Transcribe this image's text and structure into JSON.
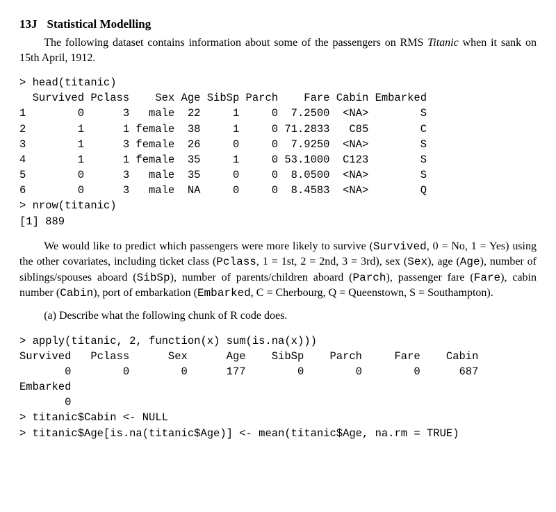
{
  "header": {
    "number": "13J",
    "title": "Statistical Modelling"
  },
  "intro": {
    "line1_a": "The following dataset contains information about some of the passengers on RMS",
    "line1_b_italic": "Titanic",
    "line1_c": " when it sank on 15th April, 1912."
  },
  "code1": "> head(titanic)\n  Survived Pclass    Sex Age SibSp Parch    Fare Cabin Embarked\n1        0      3   male  22     1     0  7.2500  <NA>        S\n2        1      1 female  38     1     0 71.2833   C85        C\n3        1      3 female  26     0     0  7.9250  <NA>        S\n4        1      1 female  35     1     0 53.1000  C123        S\n5        0      3   male  35     0     0  8.0500  <NA>        S\n6        0      3   male  NA     0     0  8.4583  <NA>        Q\n> nrow(titanic)\n[1] 889",
  "explain": {
    "seg1": "We would like to predict which passengers were more likely to survive (",
    "mono1": "Survived",
    "seg2": ", 0 = No, 1 = Yes) using the other covariates, including ticket class (",
    "mono2": "Pclass",
    "seg3": ", 1 = 1st, 2 = 2nd, 3 = 3rd), sex (",
    "mono3": "Sex",
    "seg4": "), age (",
    "mono4": "Age",
    "seg5": "), number of siblings/spouses aboard (",
    "mono5": "SibSp",
    "seg6": "), number of parents/children aboard (",
    "mono6": "Parch",
    "seg7": "), passenger fare (",
    "mono7": "Fare",
    "seg8": "), cabin number (",
    "mono8": "Cabin",
    "seg9": "), port of embarkation (",
    "mono9": "Embarked",
    "seg10": ", C = Cherbourg, Q = Queenstown, S = Southampton)."
  },
  "part_a": "(a) Describe what the following chunk of R code does.",
  "code2": "> apply(titanic, 2, function(x) sum(is.na(x)))\nSurvived   Pclass      Sex      Age    SibSp    Parch     Fare    Cabin\n       0        0        0      177        0        0        0      687\nEmbarked\n       0\n> titanic$Cabin <- NULL\n> titanic$Age[is.na(titanic$Age)] <- mean(titanic$Age, na.rm = TRUE)",
  "chart_data": {
    "type": "table",
    "title": "head(titanic)",
    "columns": [
      "Survived",
      "Pclass",
      "Sex",
      "Age",
      "SibSp",
      "Parch",
      "Fare",
      "Cabin",
      "Embarked"
    ],
    "rows": [
      {
        "row": 1,
        "Survived": 0,
        "Pclass": 3,
        "Sex": "male",
        "Age": 22,
        "SibSp": 1,
        "Parch": 0,
        "Fare": 7.25,
        "Cabin": "<NA>",
        "Embarked": "S"
      },
      {
        "row": 2,
        "Survived": 1,
        "Pclass": 1,
        "Sex": "female",
        "Age": 38,
        "SibSp": 1,
        "Parch": 0,
        "Fare": 71.2833,
        "Cabin": "C85",
        "Embarked": "C"
      },
      {
        "row": 3,
        "Survived": 1,
        "Pclass": 3,
        "Sex": "female",
        "Age": 26,
        "SibSp": 0,
        "Parch": 0,
        "Fare": 7.925,
        "Cabin": "<NA>",
        "Embarked": "S"
      },
      {
        "row": 4,
        "Survived": 1,
        "Pclass": 1,
        "Sex": "female",
        "Age": 35,
        "SibSp": 1,
        "Parch": 0,
        "Fare": 53.1,
        "Cabin": "C123",
        "Embarked": "S"
      },
      {
        "row": 5,
        "Survived": 0,
        "Pclass": 3,
        "Sex": "male",
        "Age": 35,
        "SibSp": 0,
        "Parch": 0,
        "Fare": 8.05,
        "Cabin": "<NA>",
        "Embarked": "S"
      },
      {
        "row": 6,
        "Survived": 0,
        "Pclass": 3,
        "Sex": "male",
        "Age": "NA",
        "SibSp": 0,
        "Parch": 0,
        "Fare": 8.4583,
        "Cabin": "<NA>",
        "Embarked": "Q"
      }
    ],
    "nrow_result": 889,
    "na_counts": {
      "Survived": 0,
      "Pclass": 0,
      "Sex": 0,
      "Age": 177,
      "SibSp": 0,
      "Parch": 0,
      "Fare": 0,
      "Cabin": 687,
      "Embarked": 0
    }
  }
}
